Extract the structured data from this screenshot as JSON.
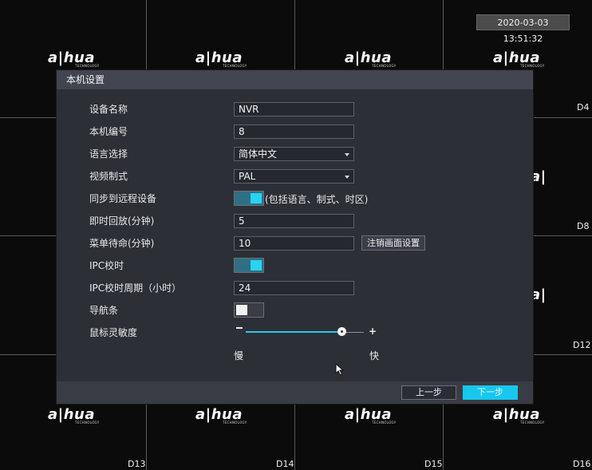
{
  "datetime": "2020-03-03 13:51:32",
  "brand": {
    "logo_text": "a|hua",
    "logo_sub": "TECHNOLOGY"
  },
  "channels": [
    "D4",
    "D8",
    "D12",
    "D13",
    "D14",
    "D15",
    "D16"
  ],
  "dialog": {
    "title": "本机设置",
    "fields": {
      "device_name": {
        "label": "设备名称",
        "value": "NVR"
      },
      "device_no": {
        "label": "本机编号",
        "value": "8"
      },
      "language": {
        "label": "语言选择",
        "value": "简体中文"
      },
      "video_standard": {
        "label": "视频制式",
        "value": "PAL"
      },
      "sync_remote": {
        "label": "同步到远程设备",
        "state": "on",
        "note": "(包括语言、制式、时区)"
      },
      "instant_playback": {
        "label": "即时回放(分钟)",
        "value": "5"
      },
      "menu_standby": {
        "label": "菜单待命(分钟)",
        "value": "10",
        "button": "注销画面设置"
      },
      "ipc_time_sync": {
        "label": "IPC校时",
        "state": "on"
      },
      "ipc_sync_period": {
        "label": "IPC校时周期（小时）",
        "value": "24"
      },
      "nav_bar": {
        "label": "导航条",
        "state": "off"
      },
      "mouse_sensitivity": {
        "label": "鼠标灵敏度",
        "level": 0.81,
        "slow_label": "慢",
        "fast_label": "快",
        "minus": "−",
        "plus": "+"
      }
    },
    "buttons": {
      "prev": "上一步",
      "next": "下一步"
    }
  },
  "colors": {
    "accent": "#17c7ee",
    "dialog_bg": "#2d2f37",
    "title_bg": "#42454f"
  }
}
